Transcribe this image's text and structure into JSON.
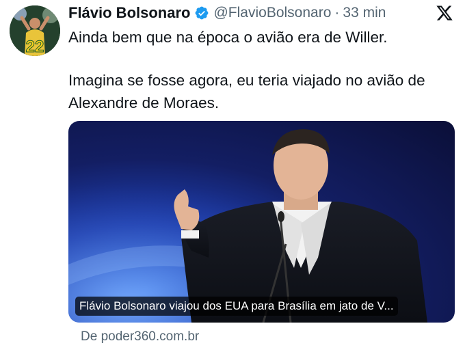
{
  "author": {
    "name": "Flávio Bolsonaro",
    "handle": "@FlavioBolsonaro",
    "separator": "·",
    "time": "33 min",
    "avatar_badge": "22"
  },
  "tweet": {
    "line1": "Ainda bem que na época o avião era de Willer.",
    "line2": "Imagina se fosse agora, eu teria viajado no avião de Alexandre de Moraes."
  },
  "card": {
    "caption": "Flávio Bolsonaro viajou dos EUA para Brasília em jato de V...",
    "source": "De poder360.com.br"
  },
  "icons": {
    "verified": "verified-badge-icon",
    "platform": "x-logo-icon"
  },
  "colors": {
    "verified": "#1d9bf0",
    "muted": "#536471",
    "text": "#0f1419"
  }
}
